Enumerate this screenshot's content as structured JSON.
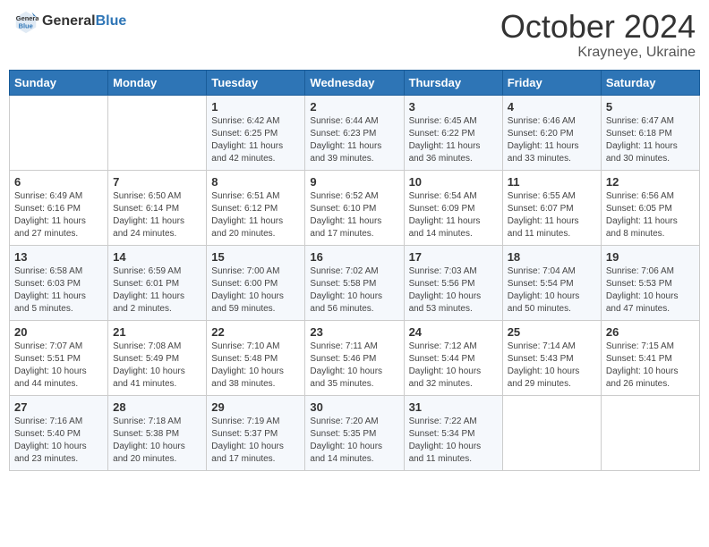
{
  "header": {
    "logo_line1": "General",
    "logo_line2": "Blue",
    "month": "October 2024",
    "location": "Krayneye, Ukraine"
  },
  "days_of_week": [
    "Sunday",
    "Monday",
    "Tuesday",
    "Wednesday",
    "Thursday",
    "Friday",
    "Saturday"
  ],
  "weeks": [
    [
      {
        "day": "",
        "info": ""
      },
      {
        "day": "",
        "info": ""
      },
      {
        "day": "1",
        "info": "Sunrise: 6:42 AM\nSunset: 6:25 PM\nDaylight: 11 hours and 42 minutes."
      },
      {
        "day": "2",
        "info": "Sunrise: 6:44 AM\nSunset: 6:23 PM\nDaylight: 11 hours and 39 minutes."
      },
      {
        "day": "3",
        "info": "Sunrise: 6:45 AM\nSunset: 6:22 PM\nDaylight: 11 hours and 36 minutes."
      },
      {
        "day": "4",
        "info": "Sunrise: 6:46 AM\nSunset: 6:20 PM\nDaylight: 11 hours and 33 minutes."
      },
      {
        "day": "5",
        "info": "Sunrise: 6:47 AM\nSunset: 6:18 PM\nDaylight: 11 hours and 30 minutes."
      }
    ],
    [
      {
        "day": "6",
        "info": "Sunrise: 6:49 AM\nSunset: 6:16 PM\nDaylight: 11 hours and 27 minutes."
      },
      {
        "day": "7",
        "info": "Sunrise: 6:50 AM\nSunset: 6:14 PM\nDaylight: 11 hours and 24 minutes."
      },
      {
        "day": "8",
        "info": "Sunrise: 6:51 AM\nSunset: 6:12 PM\nDaylight: 11 hours and 20 minutes."
      },
      {
        "day": "9",
        "info": "Sunrise: 6:52 AM\nSunset: 6:10 PM\nDaylight: 11 hours and 17 minutes."
      },
      {
        "day": "10",
        "info": "Sunrise: 6:54 AM\nSunset: 6:09 PM\nDaylight: 11 hours and 14 minutes."
      },
      {
        "day": "11",
        "info": "Sunrise: 6:55 AM\nSunset: 6:07 PM\nDaylight: 11 hours and 11 minutes."
      },
      {
        "day": "12",
        "info": "Sunrise: 6:56 AM\nSunset: 6:05 PM\nDaylight: 11 hours and 8 minutes."
      }
    ],
    [
      {
        "day": "13",
        "info": "Sunrise: 6:58 AM\nSunset: 6:03 PM\nDaylight: 11 hours and 5 minutes."
      },
      {
        "day": "14",
        "info": "Sunrise: 6:59 AM\nSunset: 6:01 PM\nDaylight: 11 hours and 2 minutes."
      },
      {
        "day": "15",
        "info": "Sunrise: 7:00 AM\nSunset: 6:00 PM\nDaylight: 10 hours and 59 minutes."
      },
      {
        "day": "16",
        "info": "Sunrise: 7:02 AM\nSunset: 5:58 PM\nDaylight: 10 hours and 56 minutes."
      },
      {
        "day": "17",
        "info": "Sunrise: 7:03 AM\nSunset: 5:56 PM\nDaylight: 10 hours and 53 minutes."
      },
      {
        "day": "18",
        "info": "Sunrise: 7:04 AM\nSunset: 5:54 PM\nDaylight: 10 hours and 50 minutes."
      },
      {
        "day": "19",
        "info": "Sunrise: 7:06 AM\nSunset: 5:53 PM\nDaylight: 10 hours and 47 minutes."
      }
    ],
    [
      {
        "day": "20",
        "info": "Sunrise: 7:07 AM\nSunset: 5:51 PM\nDaylight: 10 hours and 44 minutes."
      },
      {
        "day": "21",
        "info": "Sunrise: 7:08 AM\nSunset: 5:49 PM\nDaylight: 10 hours and 41 minutes."
      },
      {
        "day": "22",
        "info": "Sunrise: 7:10 AM\nSunset: 5:48 PM\nDaylight: 10 hours and 38 minutes."
      },
      {
        "day": "23",
        "info": "Sunrise: 7:11 AM\nSunset: 5:46 PM\nDaylight: 10 hours and 35 minutes."
      },
      {
        "day": "24",
        "info": "Sunrise: 7:12 AM\nSunset: 5:44 PM\nDaylight: 10 hours and 32 minutes."
      },
      {
        "day": "25",
        "info": "Sunrise: 7:14 AM\nSunset: 5:43 PM\nDaylight: 10 hours and 29 minutes."
      },
      {
        "day": "26",
        "info": "Sunrise: 7:15 AM\nSunset: 5:41 PM\nDaylight: 10 hours and 26 minutes."
      }
    ],
    [
      {
        "day": "27",
        "info": "Sunrise: 7:16 AM\nSunset: 5:40 PM\nDaylight: 10 hours and 23 minutes."
      },
      {
        "day": "28",
        "info": "Sunrise: 7:18 AM\nSunset: 5:38 PM\nDaylight: 10 hours and 20 minutes."
      },
      {
        "day": "29",
        "info": "Sunrise: 7:19 AM\nSunset: 5:37 PM\nDaylight: 10 hours and 17 minutes."
      },
      {
        "day": "30",
        "info": "Sunrise: 7:20 AM\nSunset: 5:35 PM\nDaylight: 10 hours and 14 minutes."
      },
      {
        "day": "31",
        "info": "Sunrise: 7:22 AM\nSunset: 5:34 PM\nDaylight: 10 hours and 11 minutes."
      },
      {
        "day": "",
        "info": ""
      },
      {
        "day": "",
        "info": ""
      }
    ]
  ]
}
